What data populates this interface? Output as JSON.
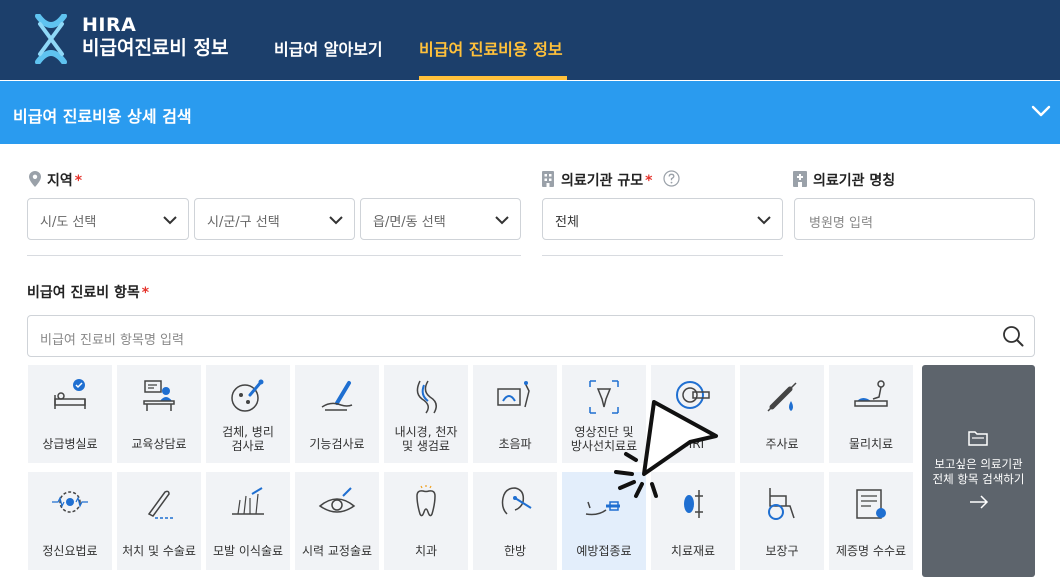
{
  "header": {
    "brand_top": "HIRA",
    "brand_bottom": "비급여진료비 정보",
    "nav": [
      {
        "label": "비급여 알아보기",
        "active": false
      },
      {
        "label": "비급여 진료비용 정보",
        "active": true
      }
    ]
  },
  "section": {
    "title": "비급여 진료비용 상세 검색"
  },
  "region": {
    "label": "지역",
    "required": "*",
    "sido": "시/도 선택",
    "sigungu": "시/군/구 선택",
    "eupmyeondong": "읍/면/동 선택"
  },
  "institution_scale": {
    "label": "의료기관 규모",
    "required": "*",
    "value": "전체"
  },
  "institution_name": {
    "label": "의료기관 명칭",
    "placeholder": "병원명 입력"
  },
  "item": {
    "label": "비급여 진료비 항목",
    "required": "*",
    "placeholder": "비급여 진료비 항목명 입력"
  },
  "categories_row1": [
    {
      "label": "상급병실료",
      "icon": "hospital-bed-icon"
    },
    {
      "label": "교육상담료",
      "icon": "consultation-icon"
    },
    {
      "label": "검체, 병리 검사료",
      "icon": "specimen-test-icon"
    },
    {
      "label": "기능검사료",
      "icon": "function-test-icon"
    },
    {
      "label": "내시경, 천자 및 생검료",
      "icon": "endoscope-icon"
    },
    {
      "label": "초음파",
      "icon": "ultrasound-icon"
    },
    {
      "label": "영상진단 및 방사선치료료",
      "icon": "imaging-icon"
    },
    {
      "label": "MRI",
      "icon": "mri-icon"
    },
    {
      "label": "주사료",
      "icon": "injection-icon"
    },
    {
      "label": "물리치료",
      "icon": "physical-therapy-icon"
    }
  ],
  "categories_row2": [
    {
      "label": "정신요법료",
      "icon": "psychotherapy-icon"
    },
    {
      "label": "처치 및 수술료",
      "icon": "surgery-icon"
    },
    {
      "label": "모발 이식술료",
      "icon": "hair-transplant-icon"
    },
    {
      "label": "시력 교정술료",
      "icon": "eye-surgery-icon"
    },
    {
      "label": "치과",
      "icon": "tooth-icon"
    },
    {
      "label": "한방",
      "icon": "oriental-medicine-icon"
    },
    {
      "label": "예방접종료",
      "icon": "vaccine-icon"
    },
    {
      "label": "치료재료",
      "icon": "treatment-material-icon"
    },
    {
      "label": "보장구",
      "icon": "wheelchair-icon"
    },
    {
      "label": "제증명 수수료",
      "icon": "certificate-icon"
    }
  ],
  "view_all_button": {
    "label": "보고싶은 의료기관 전체 항목 검색하기",
    "arrow": "→"
  },
  "colors": {
    "header_bg": "#1c3f6b",
    "section_bar_bg": "#2a9bef",
    "active_nav": "#ffc13b",
    "required": "#e5322b",
    "tile_bg": "#f1f3f6",
    "tile_active_bg": "#e3eefb",
    "view_all_bg": "#5d646c"
  }
}
